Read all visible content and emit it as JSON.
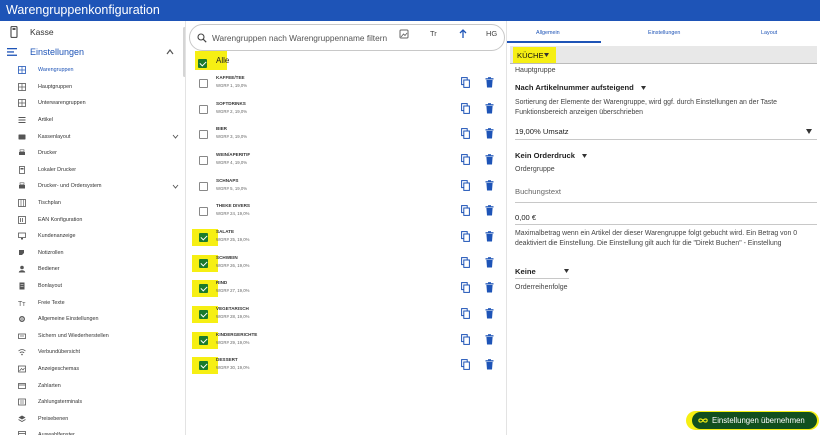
{
  "app": {
    "title": "Warengruppenkonfiguration"
  },
  "sidebar": {
    "top_item": {
      "label": "Kasse",
      "icon": "cash-register-icon"
    },
    "section": {
      "label": "Einstellungen",
      "icon": "menu-icon"
    },
    "items": [
      {
        "label": "Warengruppen",
        "icon": "grid-icon",
        "active": true
      },
      {
        "label": "Hauptgruppen",
        "icon": "grid-icon"
      },
      {
        "label": "Unterwarengruppen",
        "icon": "grid-icon"
      },
      {
        "label": "Artikel",
        "icon": "list-icon"
      },
      {
        "label": "Kassenlayout",
        "icon": "keyboard-icon",
        "expand": true
      },
      {
        "label": "Drucker",
        "icon": "printer-icon"
      },
      {
        "label": "Lokaler Drucker",
        "icon": "local-printer-icon"
      },
      {
        "label": "Drucker- und Ordersystem",
        "icon": "printer-system-icon",
        "expand": true
      },
      {
        "label": "Tischplan",
        "icon": "table-plan-icon"
      },
      {
        "label": "EAN Konfiguration",
        "icon": "barcode-icon"
      },
      {
        "label": "Kundenanzeige",
        "icon": "monitor-icon"
      },
      {
        "label": "Notizrollen",
        "icon": "notes-icon"
      },
      {
        "label": "Bediener",
        "icon": "person-icon"
      },
      {
        "label": "Bonlayout",
        "icon": "receipt-icon"
      },
      {
        "label": "Freie Texte",
        "icon": "text-icon"
      },
      {
        "label": "Allgemeine Einstellungen",
        "icon": "settings-icon"
      },
      {
        "label": "Sichern und Wiederherstellen",
        "icon": "backup-icon"
      },
      {
        "label": "Verbundübersicht",
        "icon": "wifi-icon"
      },
      {
        "label": "Anzeigeschemas",
        "icon": "display-scheme-icon"
      },
      {
        "label": "Zahlarten",
        "icon": "payment-icon"
      },
      {
        "label": "Zahlungsterminals",
        "icon": "terminal-icon"
      },
      {
        "label": "Preisebenen",
        "icon": "layers-icon"
      },
      {
        "label": "Auswahlfenster",
        "icon": "window-icon"
      }
    ]
  },
  "toolbar": {
    "search_placeholder": "Warengruppen nach  Warengruppenname filtern",
    "tr_label": "Tr",
    "hg_label": "HG"
  },
  "list": {
    "all_label": "Alle",
    "all_checked": true,
    "rows": [
      {
        "name": "KAFFEE/TEE",
        "sub": "WGR# 1, 19,0%",
        "checked": false,
        "highlight": false
      },
      {
        "name": "SOFTDRINKS",
        "sub": "WGR# 2, 19,0%",
        "checked": false,
        "highlight": false
      },
      {
        "name": "BIER",
        "sub": "WGR# 3, 19,0%",
        "checked": false,
        "highlight": false
      },
      {
        "name": "WEIN/APERITIF",
        "sub": "WGR# 4, 19,0%",
        "checked": false,
        "highlight": false
      },
      {
        "name": "SCHNAPS",
        "sub": "WGR# 5, 19,0%",
        "checked": false,
        "highlight": false
      },
      {
        "name": "THEKE DIVERS",
        "sub": "WGR# 24, 19,0%",
        "checked": false,
        "highlight": false
      },
      {
        "name": "SALATE",
        "sub": "WGR# 25, 19,0%",
        "checked": true,
        "highlight": true
      },
      {
        "name": "SCHWEIN",
        "sub": "WGR# 26, 19,0%",
        "checked": true,
        "highlight": true
      },
      {
        "name": "RIND",
        "sub": "WGR# 27, 19,0%",
        "checked": true,
        "highlight": true
      },
      {
        "name": "VEGETARISCH",
        "sub": "WGR# 28, 19,0%",
        "checked": true,
        "highlight": true
      },
      {
        "name": "KINDERGERICHTE",
        "sub": "WGR# 29, 19,0%",
        "checked": true,
        "highlight": true
      },
      {
        "name": "DESSERT",
        "sub": "WGR# 30, 19,0%",
        "checked": true,
        "highlight": true
      }
    ]
  },
  "tabs": [
    {
      "label": "Allgemein",
      "active": true
    },
    {
      "label": "Einstellungen",
      "active": false
    },
    {
      "label": "Layout",
      "active": false
    }
  ],
  "detail": {
    "hauptgruppe_value": "KÜCHE",
    "hauptgruppe_label": "Hauptgruppe",
    "sort_value": "Nach Artikelnummer aufsteigend",
    "sort_desc": "Sortierung der Elemente der Warengruppe, wird ggf. durch Einstellungen an der Taste Funktionsbereich anzeigen überschrieben",
    "tax_value": "19,00% Umsatz",
    "order_print_value": "Kein Orderdruck",
    "order_group_label": "Ordergruppe",
    "booking_text_placeholder": "Buchungstext",
    "max_amount_value": "0,00 €",
    "max_amount_desc": "Maximalbetrag wenn ein Artikel der dieser Warengruppe folgt gebucht wird. Ein Betrag von 0 deaktiviert die Einstellung. Die Einstellung gilt auch für die \"Direkt Buchen\" - Einstellung",
    "order_seq_value": "Keine",
    "order_seq_label": "Orderreihenfolge"
  },
  "apply_button": {
    "label": "Einstellungen übernehmen",
    "icon": "infinity-icon"
  },
  "colors": {
    "primary": "#1e54b7",
    "highlight": "#f6ef13",
    "check": "#1a7a2c",
    "button": "#114f1e"
  }
}
